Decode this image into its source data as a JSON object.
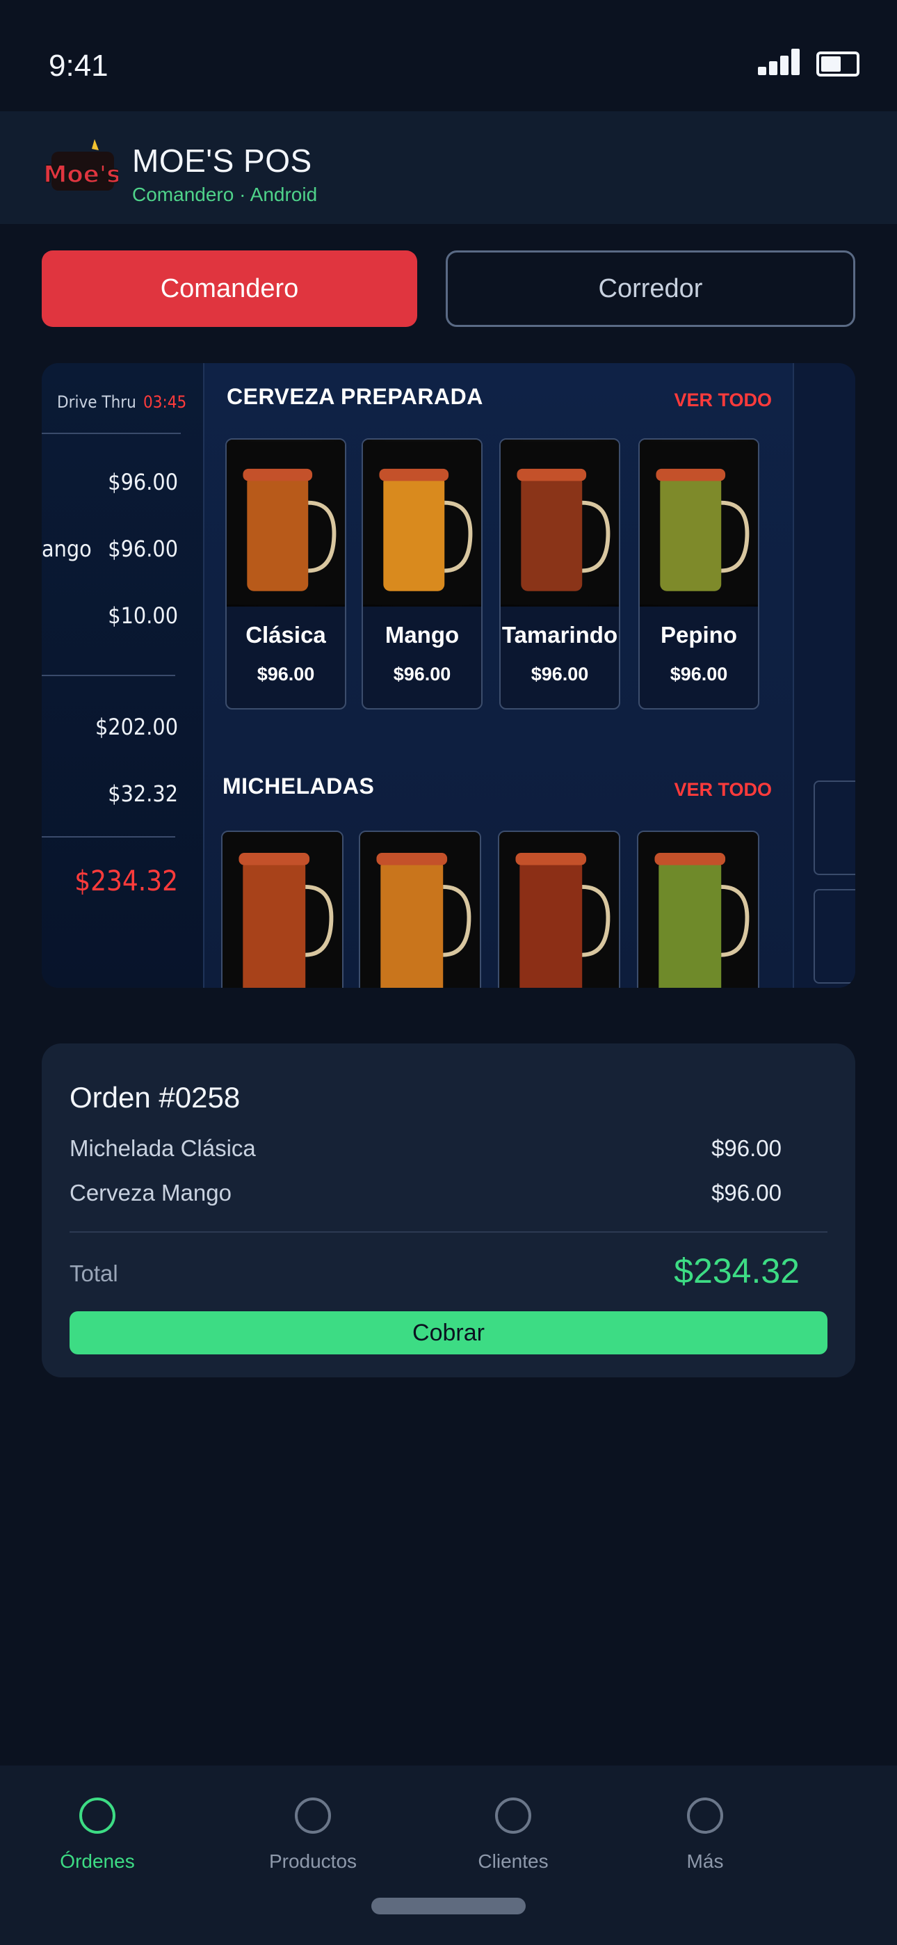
{
  "status": {
    "time": "9:41"
  },
  "header": {
    "title": "MOE'S POS",
    "subtitle": "Comandero · Android",
    "logo_text": "Moe's"
  },
  "toggle": {
    "primary_label": "Comandero",
    "secondary_label": "Corredor"
  },
  "menu_preview": {
    "left": {
      "mode": "Drive Thru",
      "timer": "03:45",
      "line_prices": [
        "$96.00",
        "$96.00",
        "$10.00"
      ],
      "partial_item": "ango",
      "subtotal": "$202.00",
      "tax": "$32.32",
      "total": "$234.32"
    },
    "sections": [
      {
        "title": "CERVEZA PREPARADA",
        "link": "VER TODO",
        "products": [
          {
            "name": "Clásica",
            "price": "$96.00",
            "color": "#b85a1a"
          },
          {
            "name": "Mango",
            "price": "$96.00",
            "color": "#d98a1e"
          },
          {
            "name": "Tamarindo",
            "price": "$96.00",
            "color": "#8a3418"
          },
          {
            "name": "Pepino",
            "price": "$96.00",
            "color": "#7e8a2a"
          }
        ]
      },
      {
        "title": "MICHELADAS",
        "link": "VER TODO",
        "products": [
          {
            "color": "#a8421a"
          },
          {
            "color": "#c9751c"
          },
          {
            "color": "#8c2f16"
          },
          {
            "color": "#6f8a2a"
          }
        ]
      }
    ]
  },
  "order": {
    "title": "Orden #0258",
    "items": [
      {
        "name": "Michelada Clásica",
        "price": "$96.00"
      },
      {
        "name": "Cerveza Mango",
        "price": "$96.00"
      }
    ],
    "total_label": "Total",
    "total_value": "$234.32",
    "action_label": "Cobrar"
  },
  "nav": [
    {
      "label": "Órdenes",
      "active": true
    },
    {
      "label": "Productos",
      "active": false
    },
    {
      "label": "Clientes",
      "active": false
    },
    {
      "label": "Más",
      "active": false
    }
  ],
  "colors": {
    "accent_red": "#e0353f",
    "accent_green": "#3ddc84",
    "background": "#0b1220"
  }
}
